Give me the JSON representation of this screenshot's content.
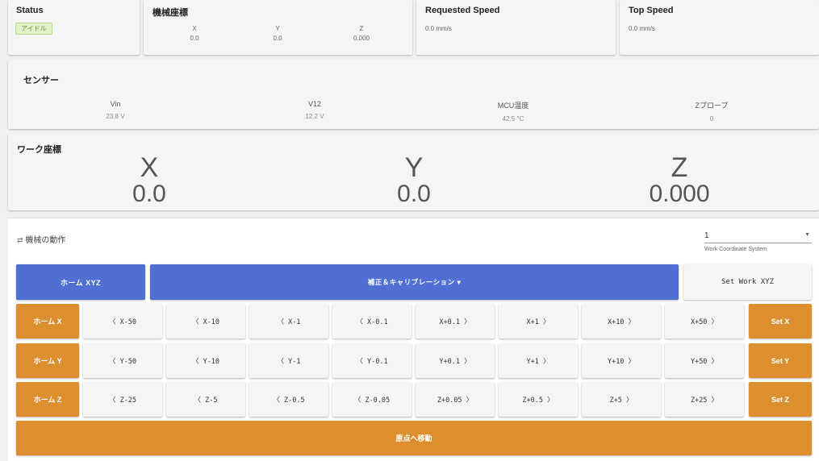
{
  "status_card": {
    "title": "Status",
    "badge": "アイドル"
  },
  "machine_coords": {
    "title": "機械座標",
    "axes": [
      {
        "label": "X",
        "value": "0.0"
      },
      {
        "label": "Y",
        "value": "0.0"
      },
      {
        "label": "Z",
        "value": "0.000"
      }
    ]
  },
  "requested_speed": {
    "title": "Requested Speed",
    "value": "0.0 mm/s"
  },
  "top_speed": {
    "title": "Top Speed",
    "value": "0.0 mm/s"
  },
  "sensors": {
    "title": "センサー",
    "items": [
      {
        "label": "Vin",
        "value": "23.8 V"
      },
      {
        "label": "V12",
        "value": "12.2 V"
      },
      {
        "label": "MCU温度",
        "value": "42.5 °C"
      },
      {
        "label": "Zプローブ",
        "value": "0"
      }
    ]
  },
  "work_coords": {
    "title": "ワーク座標",
    "axes": [
      {
        "label": "X",
        "value": "0.0"
      },
      {
        "label": "Y",
        "value": "0.0"
      },
      {
        "label": "Z",
        "value": "0.000"
      }
    ]
  },
  "machine_ops": {
    "title": "機械の動作",
    "wcs_value": "1",
    "wcs_label": "Work Coordinate System",
    "home_xyz": "ホーム XYZ",
    "calibration": "補正＆キャリブレーション ▾",
    "set_work_xyz": "Set Work XYZ",
    "rows": [
      {
        "home": "ホーム X",
        "set": "Set X",
        "jogs": [
          "〈 X-50",
          "〈 X-10",
          "〈 X-1",
          "〈 X-0.1",
          "X+0.1 〉",
          "X+1 〉",
          "X+10 〉",
          "X+50 〉"
        ]
      },
      {
        "home": "ホーム Y",
        "set": "Set Y",
        "jogs": [
          "〈 Y-50",
          "〈 Y-10",
          "〈 Y-1",
          "〈 Y-0.1",
          "Y+0.1 〉",
          "Y+1 〉",
          "Y+10 〉",
          "Y+50 〉"
        ]
      },
      {
        "home": "ホーム Z",
        "set": "Set Z",
        "jogs": [
          "〈 Z-25",
          "〈 Z-5",
          "〈 Z-0.5",
          "〈 Z-0.05",
          "Z+0.05 〉",
          "Z+0.5 〉",
          "Z+5 〉",
          "Z+25 〉"
        ]
      }
    ],
    "go_origin": "原点へ移動"
  },
  "colors": {
    "blue": "#4f6fd3",
    "orange": "#dc8f2f",
    "badge_bg": "#e3f2c6"
  }
}
